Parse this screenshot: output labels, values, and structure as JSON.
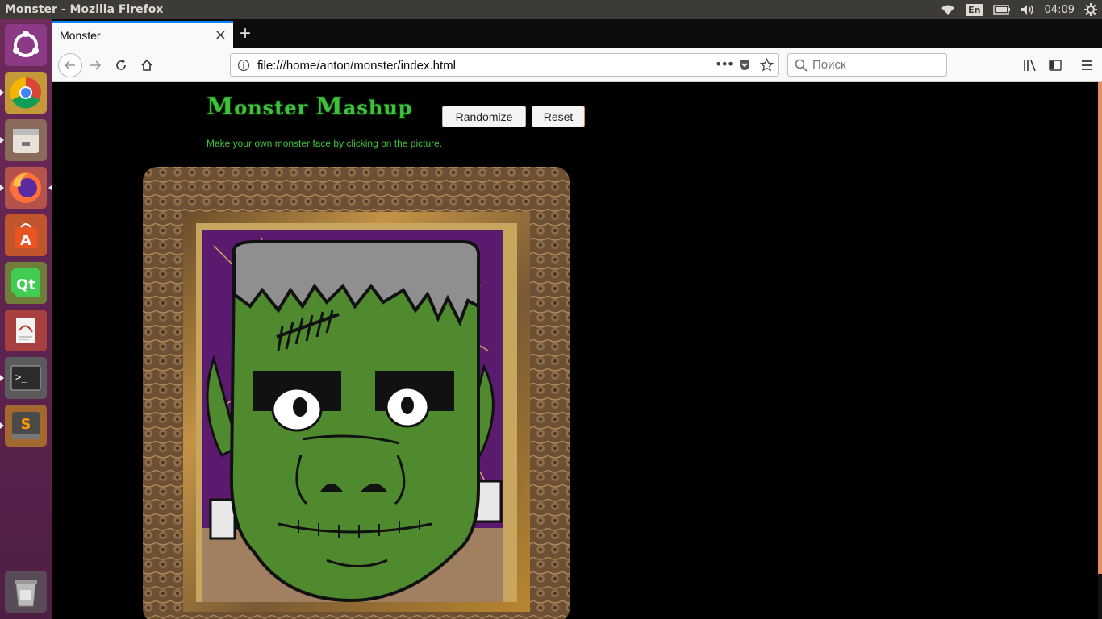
{
  "system": {
    "window_title": "Monster - Mozilla Firefox",
    "language": "En",
    "clock": "04:09"
  },
  "launcher": {
    "items": [
      "ubuntu-dash",
      "chrome",
      "files",
      "firefox",
      "software-center",
      "qt-creator",
      "document-viewer",
      "terminal",
      "sublime-text",
      "trash"
    ]
  },
  "browser": {
    "tab_title": "Monster",
    "tab_close": "×",
    "new_tab": "+",
    "url": "file:///home/anton/monster/index.html",
    "search_placeholder": "Поиск",
    "url_more": "•••"
  },
  "page": {
    "title_part1": "M",
    "title_part2": "onster ",
    "title_part3": "M",
    "title_part4": "ashup",
    "randomize_label": "Randomize",
    "reset_label": "Reset",
    "subtitle": "Make your own monster face by clicking on the picture."
  },
  "colors": {
    "accent_green": "#3ec23b",
    "frame_gold": "#b8862f",
    "monster_green": "#4f8a2f",
    "background_purple": "#5a1a6e"
  }
}
